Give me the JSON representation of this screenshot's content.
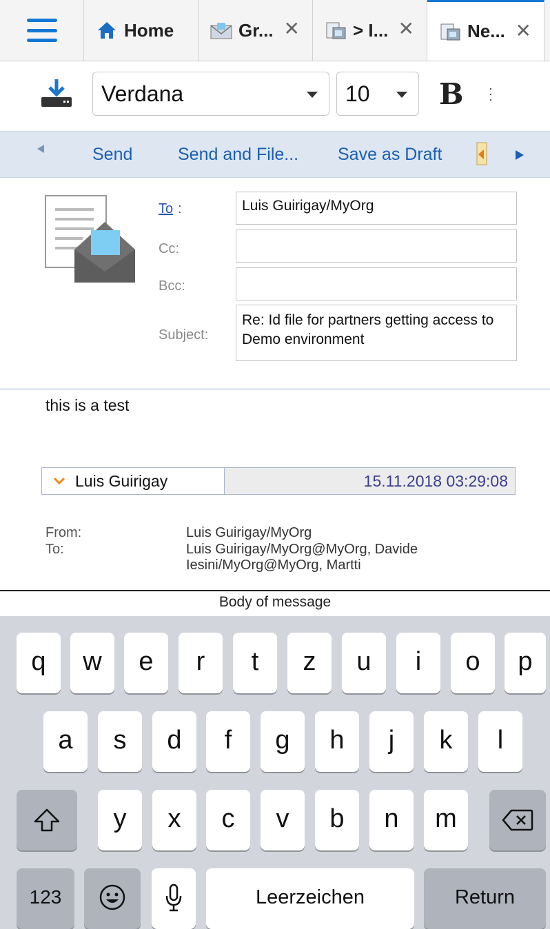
{
  "tabs": {
    "home_label": "Home",
    "tab2_label": "Gr...",
    "tab3_label": "> I...",
    "tab4_label": "Ne...",
    "close_glyph": "✕"
  },
  "toolbar": {
    "font_name": "Verdana",
    "font_size": "10",
    "bold_label": "B"
  },
  "actions": {
    "send": "Send",
    "send_and_file": "Send and File...",
    "save_as_draft": "Save as Draft"
  },
  "header": {
    "to_label": "To",
    "to_colon": ":",
    "cc_label": "Cc:",
    "bcc_label": "Bcc:",
    "subject_label": "Subject:",
    "to_value": "Luis Guirigay/MyOrg",
    "cc_value": "",
    "bcc_value": "",
    "subject_value": "Re: Id file for partners getting access to Demo environment"
  },
  "body": {
    "text": "this is a test",
    "reply": {
      "sender": "Luis Guirigay",
      "date": "15.11.2018 03:29:08",
      "from_label": "From:",
      "to_label": "To:",
      "from_value": "Luis Guirigay/MyOrg",
      "to_value": "Luis Guirigay/MyOrg@MyOrg, Davide Iesini/MyOrg@MyOrg, Martti"
    },
    "caption": "Body of message"
  },
  "keyboard": {
    "row1": [
      "q",
      "w",
      "e",
      "r",
      "t",
      "z",
      "u",
      "i",
      "o",
      "p"
    ],
    "row2": [
      "a",
      "s",
      "d",
      "f",
      "g",
      "h",
      "j",
      "k",
      "l"
    ],
    "row3": [
      "y",
      "x",
      "c",
      "v",
      "b",
      "n",
      "m"
    ],
    "numbers_label": "123",
    "space_label": "Leerzeichen",
    "return_label": "Return"
  },
  "colors": {
    "accent": "#1478d4",
    "action_bar": "#dde6f1",
    "link": "#1a5fb4",
    "chevron": "#f08a16"
  }
}
